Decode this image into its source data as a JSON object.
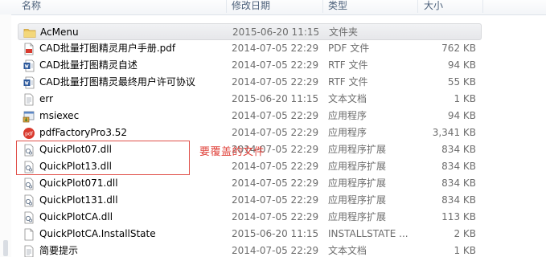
{
  "columns": {
    "name": "名称",
    "date": "修改日期",
    "type": "类型",
    "size": "大小"
  },
  "files": [
    {
      "name": "AcMenu",
      "date": "2015-06-20 11:15",
      "type": "文件夹",
      "size": "",
      "icon": "folder-icon"
    },
    {
      "name": "CAD批量打图精灵用户手册.pdf",
      "date": "2014-07-05 22:29",
      "type": "PDF 文件",
      "size": "762 KB",
      "icon": "pdf-file-icon"
    },
    {
      "name": "CAD批量打图精灵自述",
      "date": "2014-07-05 22:29",
      "type": "RTF 文件",
      "size": "94 KB",
      "icon": "rtf-file-icon"
    },
    {
      "name": "CAD批量打图精灵最终用户许可协议",
      "date": "2014-07-05 22:29",
      "type": "RTF 文件",
      "size": "55 KB",
      "icon": "rtf-file-icon"
    },
    {
      "name": "err",
      "date": "2015-06-20 11:15",
      "type": "文本文档",
      "size": "1 KB",
      "icon": "text-file-icon"
    },
    {
      "name": "msiexec",
      "date": "2014-07-05 22:29",
      "type": "应用程序",
      "size": "94 KB",
      "icon": "installer-icon"
    },
    {
      "name": "pdfFactoryPro3.52",
      "date": "2014-07-05 22:29",
      "type": "应用程序",
      "size": "3,341 KB",
      "icon": "pdf-app-icon"
    },
    {
      "name": "QuickPlot07.dll",
      "date": "2014-07-05 22:29",
      "type": "应用程序扩展",
      "size": "834 KB",
      "icon": "dll-file-icon"
    },
    {
      "name": "QuickPlot13.dll",
      "date": "2014-07-05 22:29",
      "type": "应用程序扩展",
      "size": "834 KB",
      "icon": "dll-file-icon"
    },
    {
      "name": "QuickPlot071.dll",
      "date": "2014-07-05 22:29",
      "type": "应用程序扩展",
      "size": "834 KB",
      "icon": "dll-file-icon"
    },
    {
      "name": "QuickPlot131.dll",
      "date": "2014-07-05 22:29",
      "type": "应用程序扩展",
      "size": "834 KB",
      "icon": "dll-file-icon"
    },
    {
      "name": "QuickPlotCA.dll",
      "date": "2014-07-05 22:29",
      "type": "应用程序扩展",
      "size": "113 KB",
      "icon": "dll-file-icon"
    },
    {
      "name": "QuickPlotCA.InstallState",
      "date": "2015-06-20 11:15",
      "type": "INSTALLSTATE ...",
      "size": "2 KB",
      "icon": "generic-file-icon"
    },
    {
      "name": "简要提示",
      "date": "2014-07-05 22:29",
      "type": "文本文档",
      "size": "1 KB",
      "icon": "text-file-icon"
    }
  ],
  "annotation": {
    "text": "要覆盖的文件",
    "color": "#e0443d"
  },
  "colors": {
    "selected_row": "#e8e9ec",
    "pdf_red": "#d93a2e",
    "rtf_blue": "#2b579a",
    "folder_yellow": "#e8c15a"
  }
}
